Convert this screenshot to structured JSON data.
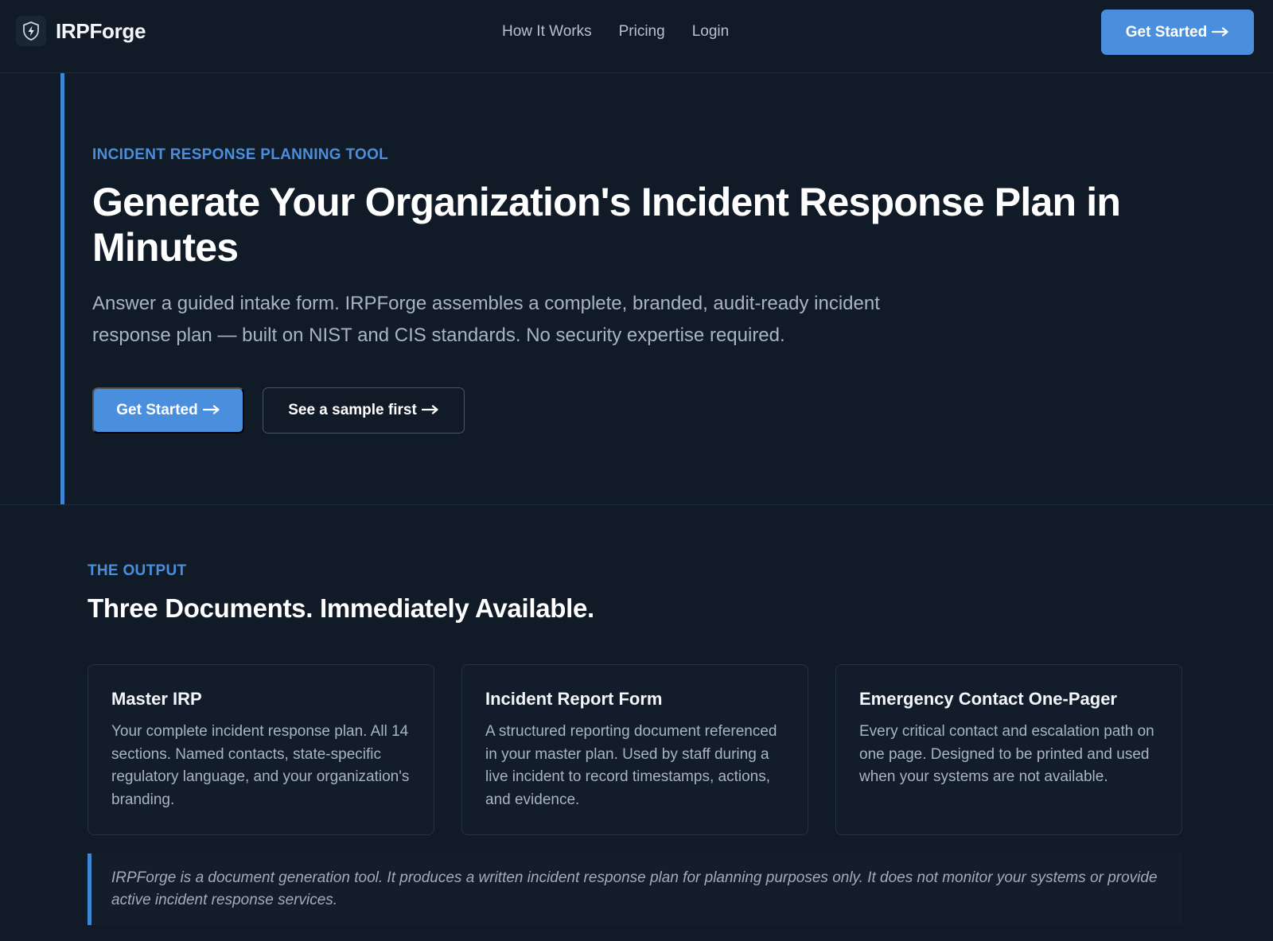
{
  "header": {
    "brand_name": "IRPForge",
    "brand_icon": "shield-bolt-icon",
    "nav": [
      "How It Works",
      "Pricing",
      "Login"
    ],
    "cta_label": "Get Started"
  },
  "hero": {
    "eyebrow": "INCIDENT RESPONSE PLANNING TOOL",
    "title": "Generate Your Organization's Incident Response Plan in Minutes",
    "subtitle": "Answer a guided intake form. IRPForge assembles a complete, branded, audit-ready incident response plan — built on NIST and CIS standards. No security expertise required.",
    "primary_label": "Get Started",
    "secondary_label": "See a sample first"
  },
  "output": {
    "eyebrow": "THE OUTPUT",
    "title": "Three Documents. Immediately Available.",
    "cards": [
      {
        "title": "Master IRP",
        "body": "Your complete incident response plan. All 14 sections. Named contacts, state-specific regulatory language, and your organization's branding."
      },
      {
        "title": "Incident Report Form",
        "body": "A structured reporting document referenced in your master plan. Used by staff during a live incident to record timestamps, actions, and evidence."
      },
      {
        "title": "Emergency Contact One-Pager",
        "body": "Every critical contact and escalation path on one page. Designed to be printed and used when your systems are not available."
      }
    ],
    "notice": "IRPForge is a document generation tool. It produces a written incident response plan for planning purposes only. It does not monitor your systems or provide active incident response services."
  },
  "colors": {
    "background": "#111a27",
    "accent": "#4a8fde",
    "text_primary": "#ffffff",
    "text_muted": "#a9b4c3"
  },
  "icons": {
    "arrow": "arrow-right-icon"
  }
}
